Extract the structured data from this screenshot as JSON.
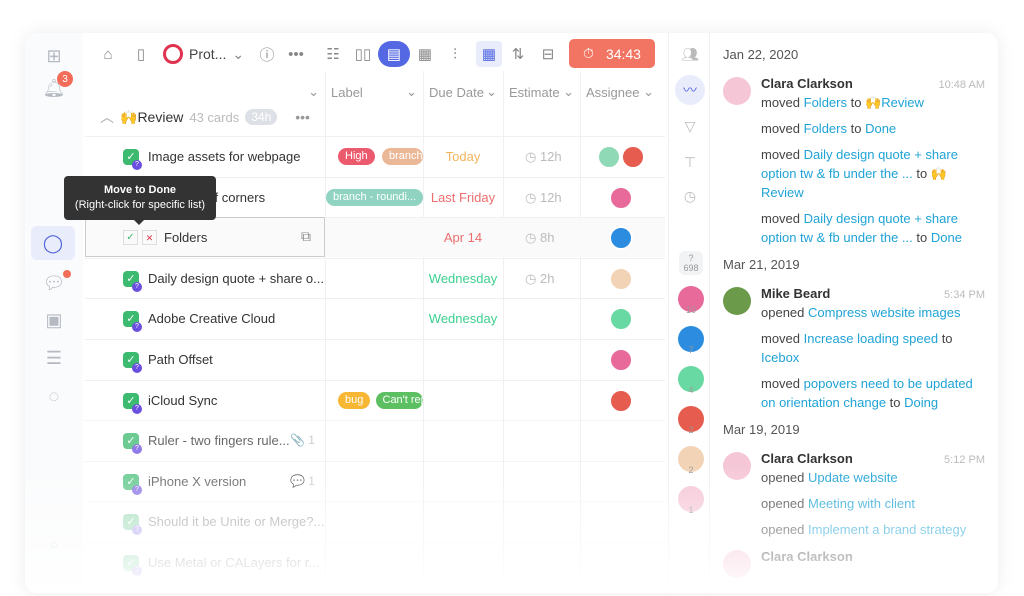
{
  "nav": {
    "notification_count": "3"
  },
  "toolbar": {
    "project": "Prot...",
    "timer": "34:43"
  },
  "columns": [
    "Label",
    "Due Date",
    "Estimate",
    "Assignee"
  ],
  "group": {
    "name": "Review",
    "count": "43 cards",
    "hours": "34h"
  },
  "tooltip": {
    "title": "Move to Done",
    "subtitle": "(Right-click for specific list)"
  },
  "rows": [
    {
      "title": "Image assets for webpage",
      "tags": [
        {
          "text": "High",
          "color": "#ec5a6e"
        },
        {
          "text": "branch",
          "color": "#ebb897"
        }
      ],
      "due": "Today",
      "due_color": "#f3b55c",
      "estimate": "12h",
      "avatars": [
        "#8fd9b6",
        "#e65c4f"
      ]
    },
    {
      "title": "Rounding of corners",
      "tags": [
        {
          "text": "branch - roundi...",
          "color": "#8fd3c0"
        }
      ],
      "due": "Last Friday",
      "due_color": "#ec6e6e",
      "estimate": "12h",
      "avatars": [
        "#e86a9a"
      ]
    },
    {
      "title": "Folders",
      "tags": [],
      "due": "Apr 14",
      "due_color": "#ec6e6e",
      "estimate": "8h",
      "avatars": [
        "#2c8ce0"
      ]
    },
    {
      "title": "Daily design quote + share o...",
      "tags": [],
      "due": "Wednesday",
      "due_color": "#3ccf8e",
      "estimate": "2h",
      "avatars": [
        "#f3d3b5"
      ]
    },
    {
      "title": "Adobe Creative Cloud",
      "tags": [],
      "due": "Wednesday",
      "due_color": "#3ccf8e",
      "estimate": "",
      "avatars": [
        "#69d9a4"
      ]
    },
    {
      "title": "Path Offset",
      "tags": [],
      "due": "",
      "estimate": "",
      "avatars": [
        "#e86a9a"
      ]
    },
    {
      "title": "iCloud Sync",
      "tags": [
        {
          "text": "bug",
          "color": "#f7b733"
        },
        {
          "text": "Can't rep",
          "color": "#5cbf62"
        }
      ],
      "due": "",
      "estimate": "",
      "avatars": [
        "#e65c4f"
      ]
    },
    {
      "title": "Ruler - two fingers rule...",
      "meta": "📎 1",
      "tags": [],
      "due": "",
      "estimate": "",
      "avatars": []
    },
    {
      "title": "iPhone X version",
      "meta": "💬 1",
      "tags": [],
      "due": "",
      "estimate": "",
      "avatars": []
    },
    {
      "title": "Should it be Unite or Merge?...",
      "tags": [],
      "due": "",
      "estimate": "",
      "avatars": []
    },
    {
      "title": "Use Metal or CALayers for r...",
      "tags": [],
      "due": "",
      "estimate": "",
      "avatars": []
    }
  ],
  "members": {
    "unassigned_count": "698",
    "people": [
      {
        "color": "#e86a9a",
        "count": "10"
      },
      {
        "color": "#2c8ce0",
        "count": "7"
      },
      {
        "color": "#69d9a4",
        "count": "4"
      },
      {
        "color": "#e65c4f",
        "count": "2"
      },
      {
        "color": "#f3d3b5",
        "count": "2"
      },
      {
        "color": "#f5c6d6",
        "count": "1"
      }
    ]
  },
  "activity": [
    {
      "date": "Jan 22, 2020",
      "entries": [
        {
          "name": "Clara Clarkson",
          "time": "10:48 AM",
          "color": "#f5c6d6",
          "actions": [
            [
              {
                "t": "moved "
              },
              {
                "l": "Folders"
              },
              {
                "t": " to "
              },
              {
                "l": "🙌Review"
              }
            ],
            [
              {
                "t": "moved "
              },
              {
                "l": "Folders"
              },
              {
                "t": " to "
              },
              {
                "l": "Done"
              }
            ],
            [
              {
                "t": "moved "
              },
              {
                "l": "Daily design quote + share option tw & fb under the ..."
              },
              {
                "t": " to "
              },
              {
                "l": "🙌Review"
              }
            ],
            [
              {
                "t": "moved "
              },
              {
                "l": "Daily design quote + share option tw & fb under the ..."
              },
              {
                "t": " to "
              },
              {
                "l": "Done"
              }
            ]
          ]
        }
      ]
    },
    {
      "date": "Mar 21, 2019",
      "entries": [
        {
          "name": "Mike Beard",
          "time": "5:34 PM",
          "color": "#6a9a4a",
          "actions": [
            [
              {
                "t": "opened "
              },
              {
                "l": "Compress website images"
              }
            ],
            [
              {
                "t": "moved "
              },
              {
                "l": "Increase loading speed"
              },
              {
                "t": " to "
              },
              {
                "l": "Icebox"
              }
            ],
            [
              {
                "t": "moved "
              },
              {
                "l": "popovers need to be updated on orientation change"
              },
              {
                "t": " to "
              },
              {
                "l": "Doing"
              }
            ]
          ]
        }
      ]
    },
    {
      "date": "Mar 19, 2019",
      "entries": [
        {
          "name": "Clara Clarkson",
          "time": "5:12 PM",
          "color": "#f5c6d6",
          "actions": [
            [
              {
                "t": "opened "
              },
              {
                "l": "Update website"
              }
            ],
            [
              {
                "t": "opened "
              },
              {
                "l": "Meeting with client"
              }
            ],
            [
              {
                "t": "opened "
              },
              {
                "l": "Implement a brand strategy"
              }
            ]
          ]
        },
        {
          "name": "Clara Clarkson",
          "time": "",
          "color": "#f5c6d6",
          "actions": []
        }
      ]
    }
  ]
}
